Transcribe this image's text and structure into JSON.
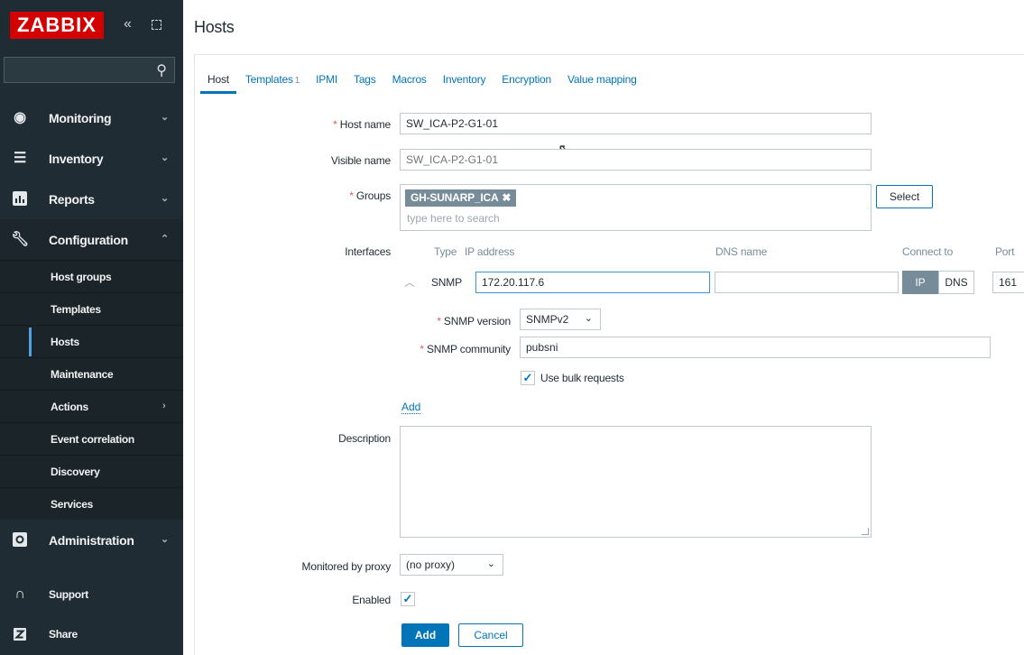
{
  "sidebar": {
    "logo": "ZABBIX",
    "collapse_glyph": "«",
    "search_placeholder": "",
    "menu": [
      {
        "label": "Monitoring",
        "icon": "eye-icon"
      },
      {
        "label": "Inventory",
        "icon": "list-icon"
      },
      {
        "label": "Reports",
        "icon": "bar-chart-icon"
      },
      {
        "label": "Configuration",
        "icon": "wrench-icon"
      }
    ],
    "submenu": [
      {
        "label": "Host groups"
      },
      {
        "label": "Templates"
      },
      {
        "label": "Hosts"
      },
      {
        "label": "Maintenance"
      },
      {
        "label": "Actions"
      },
      {
        "label": "Event correlation"
      },
      {
        "label": "Discovery"
      },
      {
        "label": "Services"
      }
    ],
    "admin": {
      "label": "Administration",
      "icon": "cog-square-icon"
    },
    "support": {
      "label": "Support",
      "icon": "headset-icon"
    },
    "share": {
      "label": "Share",
      "icon": "z-icon"
    }
  },
  "page": {
    "title": "Hosts"
  },
  "tabs": [
    {
      "label": "Host"
    },
    {
      "label": "Templates",
      "count": "1"
    },
    {
      "label": "IPMI"
    },
    {
      "label": "Tags"
    },
    {
      "label": "Macros"
    },
    {
      "label": "Inventory"
    },
    {
      "label": "Encryption"
    },
    {
      "label": "Value mapping"
    }
  ],
  "form": {
    "host_name_label": "Host name",
    "host_name_value": "SW_ICA-P2-G1-01",
    "visible_name_label": "Visible name",
    "visible_name_placeholder": "SW_ICA-P2-G1-01",
    "groups_label": "Groups",
    "group_chip": "GH-SUNARP_ICA",
    "group_search_placeholder": "type here to search",
    "select_button": "Select",
    "interfaces_label": "Interfaces",
    "interfaces": {
      "col_type": "Type",
      "col_ip": "IP address",
      "col_dns": "DNS name",
      "col_connect": "Connect to",
      "col_port": "Port",
      "row_type": "SNMP",
      "ip_value": "172.20.117.6",
      "dns_value": "",
      "connect_ip": "IP",
      "connect_dns": "DNS",
      "port_value": "161",
      "snmp_version_label": "SNMP version",
      "snmp_version_value": "SNMPv2",
      "snmp_community_label": "SNMP community",
      "snmp_community_value": "pubsni",
      "bulk_label": "Use bulk requests"
    },
    "add_interface_link": "Add",
    "description_label": "Description",
    "description_value": "",
    "proxy_label": "Monitored by proxy",
    "proxy_value": "(no proxy)",
    "enabled_label": "Enabled",
    "add_button": "Add",
    "cancel_button": "Cancel"
  },
  "colors": {
    "sidebar_bg": "#1f2c33",
    "logo_bg": "#d40000",
    "accent": "#0275b8",
    "required": "#e45959"
  }
}
